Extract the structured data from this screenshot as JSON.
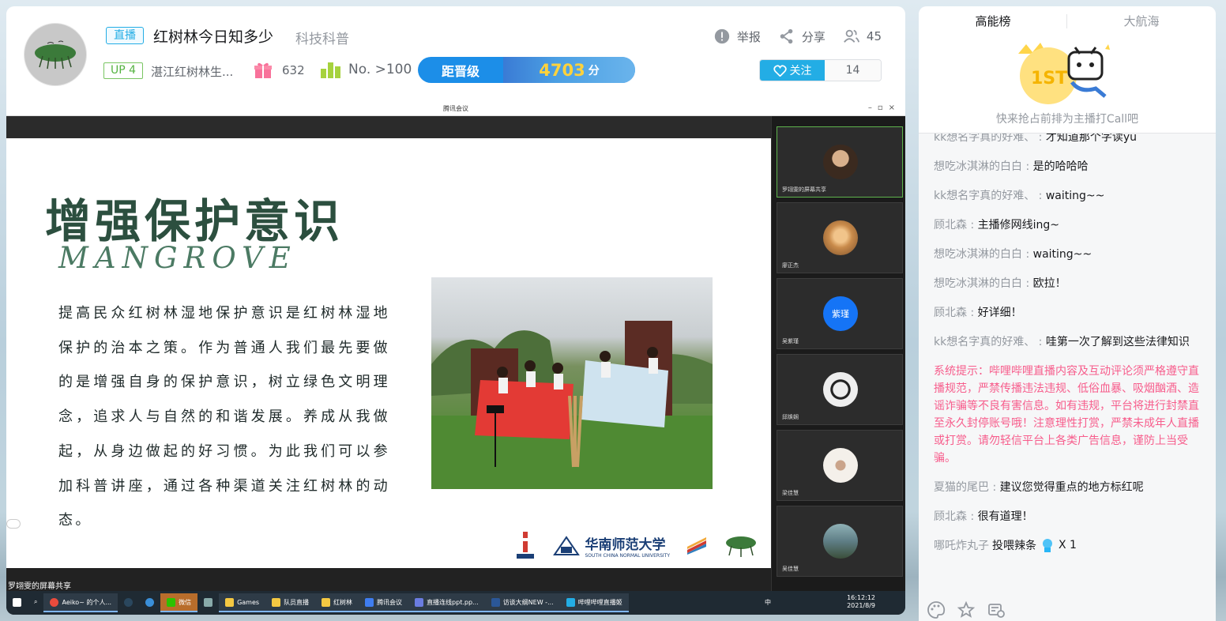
{
  "header": {
    "live_tag": "直播",
    "room_title": "红树林今日知多少",
    "room_area": "科技科普",
    "actions": {
      "report": "举报",
      "share": "分享",
      "viewers": "45"
    },
    "up_level": "UP 4",
    "up_name": "湛江红树林生...",
    "gift_count": "632",
    "rank": "No. >100",
    "level_label": "距晋级",
    "level_points": "4703",
    "level_unit": "分",
    "follow_label": "关注",
    "follow_count": "14"
  },
  "video": {
    "window_title": "腾讯会议",
    "slide": {
      "heading": "增强保护意识",
      "subheading": "MANGROVE",
      "body": "提高民众红树林湿地保护意识是红树林湿地保护的治本之策。作为普通人我们最先要做的是增强自身的保护意识，树立绿色文明理念，追求人与自然的和谐发展。养成从我做起，从身边做起的好习惯。为此我们可以参加科普讲座，通过各种渠道关注红树林的动态。",
      "university_cn": "华南师范大学",
      "university_en": "SOUTH CHINA NORMAL UNIVERSITY"
    },
    "share_label": "罗翊雯的屏幕共享",
    "participants": [
      {
        "name": "罗翊雯的屏幕共享",
        "kind": "photo",
        "color": "#3b2a1f"
      },
      {
        "name": "廖正杰",
        "kind": "photo",
        "color": "#c98b4b"
      },
      {
        "name": "吴紫瑾",
        "kind": "initials",
        "initials": "紫瑾"
      },
      {
        "name": "邱焕娴",
        "kind": "photo",
        "color": "#d9d9d9"
      },
      {
        "name": "梁佳慧",
        "kind": "photo",
        "color": "#e8e2da"
      },
      {
        "name": "吴佳慧",
        "kind": "photo",
        "color": "#5f7e86"
      }
    ],
    "taskbar": {
      "items": [
        "Aeiko~ 的个人...",
        "",
        "微信",
        "",
        "Games",
        "队员直播",
        "红树林",
        "腾讯会议",
        "直播连线ppt.pp...",
        "访谈大纲NEW -...",
        "哔哩哔哩直播姬"
      ],
      "time": "16:12:12",
      "date": "2021/8/9",
      "ime": "中"
    }
  },
  "chat": {
    "tabs": [
      "高能榜",
      "大航海"
    ],
    "rank_hint": "快来抢占前排为主播打Call吧",
    "messages": [
      {
        "user": "kk想名字真的好难、",
        "text": "才知道那个字读yu"
      },
      {
        "user": "想吃冰淇淋的白白",
        "text": "是的哈哈哈"
      },
      {
        "user": "kk想名字真的好难、",
        "text": "waiting~~"
      },
      {
        "user": "顾北森",
        "text": "主播修网线ing~"
      },
      {
        "user": "想吃冰淇淋的白白",
        "text": "waiting~~"
      },
      {
        "user": "想吃冰淇淋的白白",
        "text": "欧拉！"
      },
      {
        "user": "顾北森",
        "text": "好详细！"
      },
      {
        "user": "kk想名字真的好难、",
        "text": "哇第一次了解到这些法律知识"
      }
    ],
    "system_notice": "系统提示：哔哩哔哩直播内容及互动评论须严格遵守直播规范，严禁传播违法违规、低俗血暴、吸烟酗酒、造谣诈骗等不良有害信息。如有违规，平台将进行封禁直至永久封停账号哦！注意理性打赏，严禁未成年人直播或打赏。请勿轻信平台上各类广告信息，谨防上当受骗。",
    "messages2": [
      {
        "user": "夏猫的尾巴",
        "text": "建议您觉得重点的地方标红呢"
      },
      {
        "user": "顾北森",
        "text": "很有道理！"
      }
    ],
    "gift": {
      "user": "哪吒炸丸子",
      "action": "投喂辣条",
      "count": "X 1"
    }
  },
  "colors": {
    "accent": "#23ade5",
    "system": "#f75d8c",
    "up_green": "#55b341"
  }
}
